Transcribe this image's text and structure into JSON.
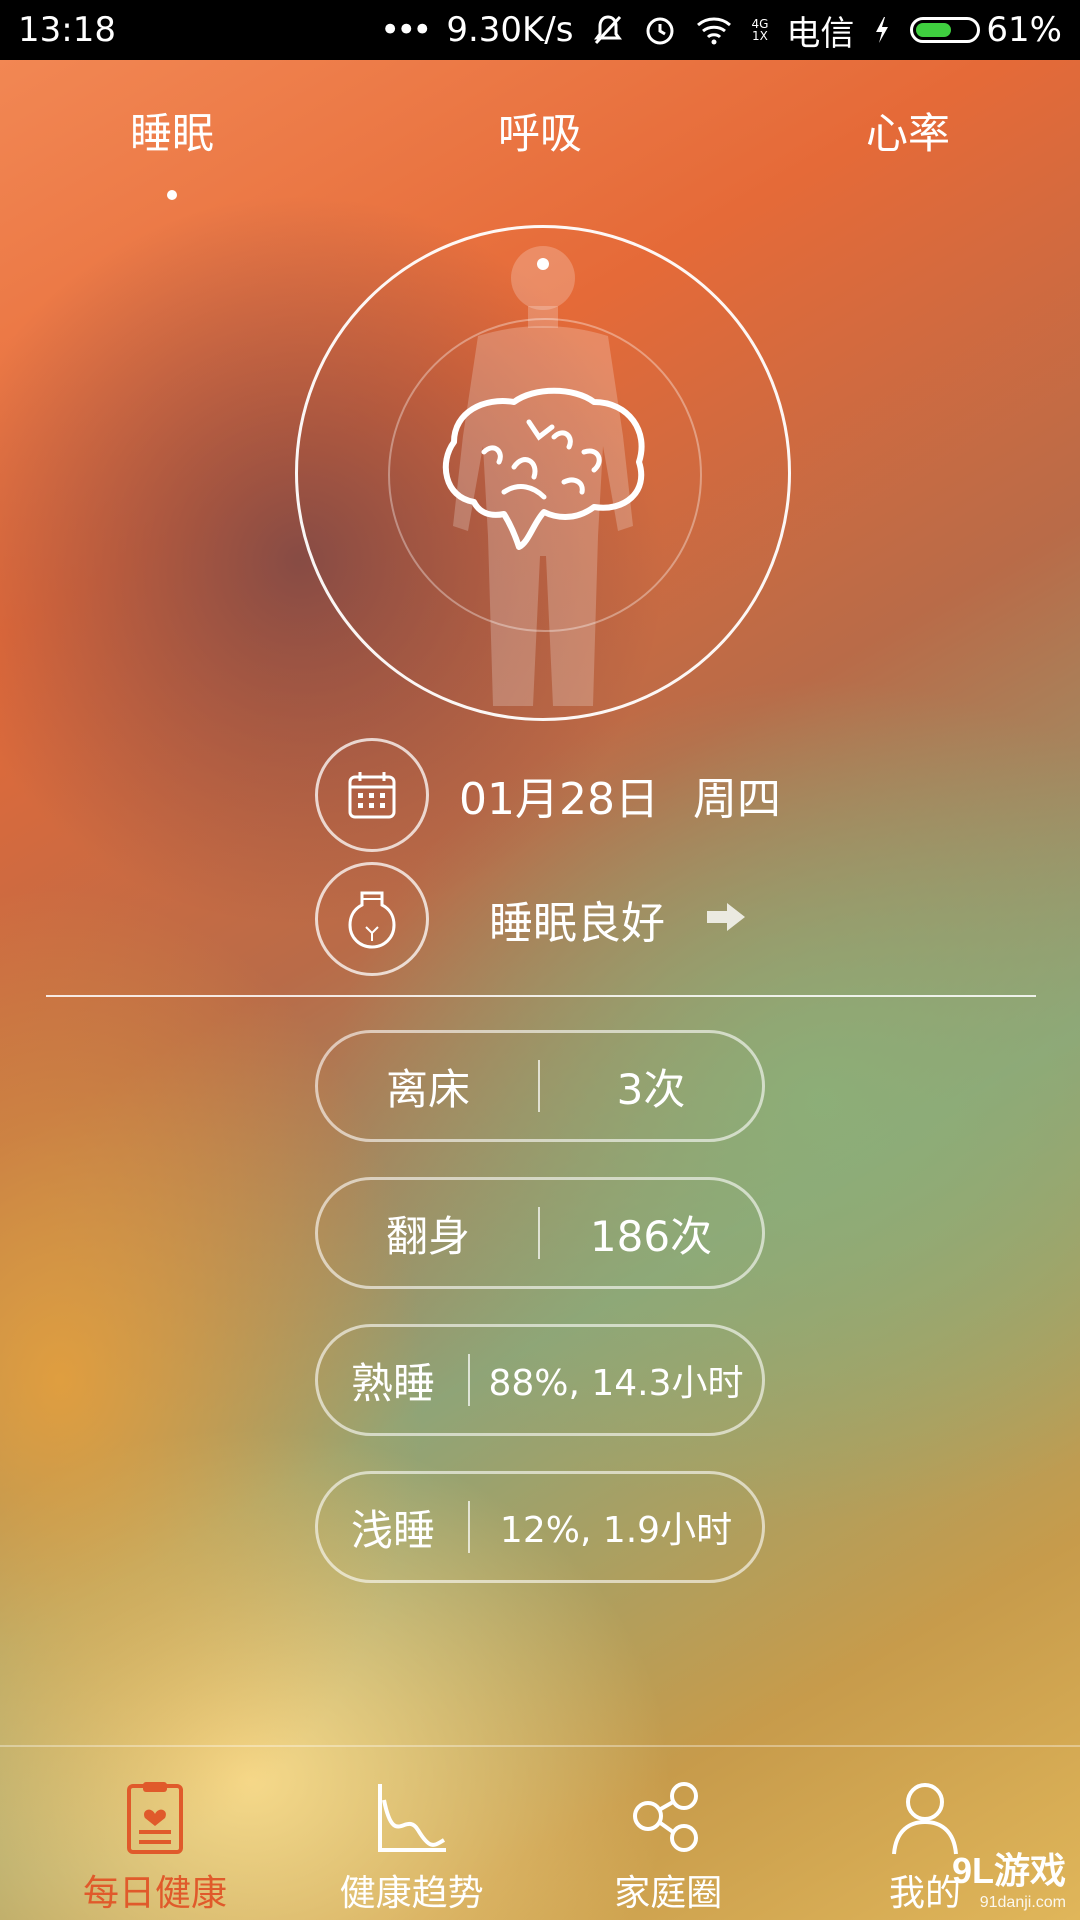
{
  "status_bar": {
    "time": "13:18",
    "speed": "9.30K/s",
    "network_top": "4G",
    "network_bottom": "1X",
    "carrier": "电信",
    "battery": "61%",
    "battery_level": 0.61
  },
  "tabs": [
    {
      "label": "睡眠",
      "active": true
    },
    {
      "label": "呼吸",
      "active": false
    },
    {
      "label": "心率",
      "active": false
    }
  ],
  "date_row": {
    "date": "01月28日",
    "weekday": "周四"
  },
  "sleep_status": {
    "text": "睡眠良好"
  },
  "metrics": [
    {
      "label": "离床",
      "value": "3次"
    },
    {
      "label": "翻身",
      "value": "186次"
    },
    {
      "label": "熟睡",
      "value": "88%, 14.3小时"
    },
    {
      "label": "浅睡",
      "value": "12%, 1.9小时"
    }
  ],
  "bottom_nav": [
    {
      "label": "每日健康",
      "icon": "clipboard-heart-icon",
      "active": true
    },
    {
      "label": "健康趋势",
      "icon": "trend-chart-icon",
      "active": false
    },
    {
      "label": "家庭圈",
      "icon": "family-circle-icon",
      "active": false
    },
    {
      "label": "我的",
      "icon": "user-icon",
      "active": false
    }
  ],
  "watermark": {
    "logo": "9L游戏",
    "url": "91danji.com"
  },
  "colors": {
    "accent": "#e05a2b",
    "battery_fill": "#3fcf3f"
  }
}
